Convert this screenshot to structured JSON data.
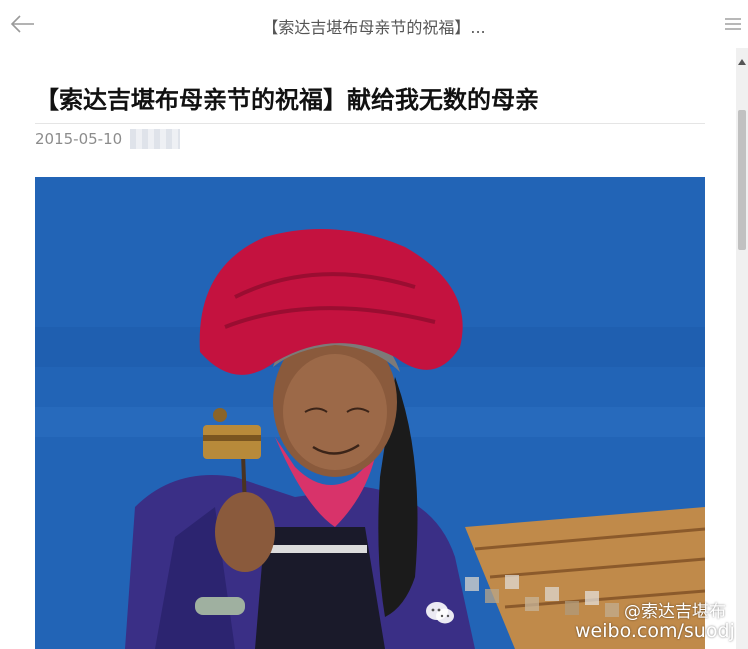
{
  "topbar": {
    "title": "【索达吉堪布母亲节的祝福】..."
  },
  "article": {
    "title": "【索达吉堪布母亲节的祝福】献给我无数的母亲",
    "date": "2015-05-10"
  },
  "photo": {
    "watermark_handle": "@索达吉堪布",
    "watermark_url": "weibo.com/suodj"
  },
  "colors": {
    "sky": "#1f5fb2",
    "hat": "#c4123f",
    "jacket": "#3a2f86",
    "title_text": "#111111",
    "meta_text": "#8c8c8c"
  },
  "icons": [
    "back-arrow-icon",
    "menu-icon",
    "scroll-up-arrow-icon",
    "wechat-logo-icon"
  ]
}
